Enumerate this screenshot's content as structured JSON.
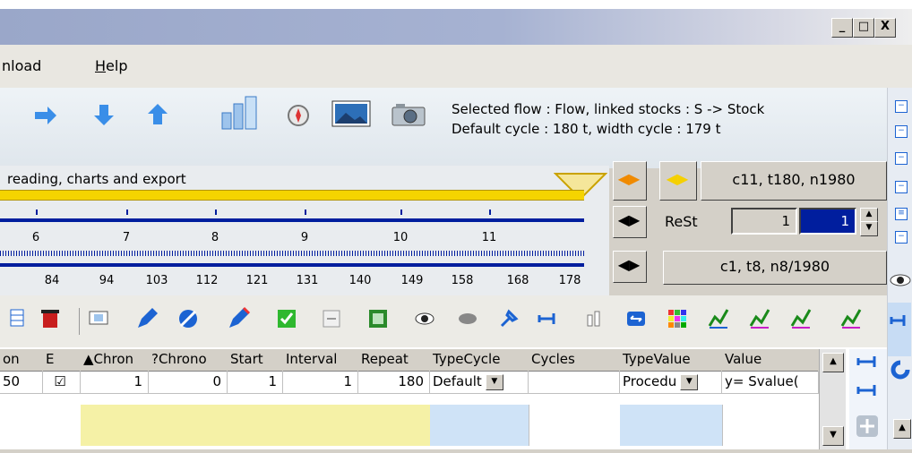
{
  "window": {
    "minimize_label": "_",
    "maximize_label": "□",
    "close_label": "X"
  },
  "menu": {
    "items": [
      "nload",
      "Help"
    ]
  },
  "selection_info": {
    "line1": "Selected flow : Flow,  linked stocks :  S -> Stock",
    "line2": "Default cycle : 180 t,  width cycle : 179 t"
  },
  "timeline": {
    "label": "reading, charts and  export",
    "row1_ticks": [
      "6",
      "7",
      "8",
      "9",
      "10",
      "11"
    ],
    "row2_ticks": [
      "84",
      "94",
      "103",
      "112",
      "121",
      "131",
      "140",
      "149",
      "158",
      "168",
      "178"
    ]
  },
  "controls": {
    "cycle_display": "c11, t180, n1980",
    "rest_label": "ReSt",
    "rest_value1": "1",
    "rest_value2": "1",
    "step_display": "c1, t8, n8/1980"
  },
  "grid": {
    "columns": [
      "on",
      "E",
      "Chron",
      "?Chrono",
      "Start",
      "Interval",
      "Repeat",
      "TypeCycle",
      "Cycles",
      "TypeValue",
      "Value"
    ],
    "row": {
      "on": "50",
      "e_checked": "☑",
      "chron": "1",
      "chrono": "0",
      "start": "1",
      "interval": "1",
      "repeat": "180",
      "typecycle": "Default",
      "cycles": "",
      "typevalue": "Procedu",
      "value": "y= Svalue("
    }
  },
  "colors": {
    "accent_blue": "#1c63d2",
    "timeline_blue": "#001e9e",
    "timeline_yellow": "#f5d400",
    "highlight_cell": "#001e9e",
    "row_yellow": "#f5f1a6",
    "row_blue": "#cfe3f7"
  },
  "icons": [
    "arrow-right-icon",
    "arrow-down-icon",
    "arrow-up-icon",
    "bar-chart-icon",
    "compass-icon",
    "landscape-icon",
    "camera-icon",
    "delete-icon",
    "edit-icon",
    "pencil-icon",
    "checkbox-icon",
    "minus-icon",
    "export-icon",
    "eye-icon",
    "pin-icon",
    "columns-icon",
    "swap-icon",
    "palette-icon",
    "chart-icon"
  ]
}
